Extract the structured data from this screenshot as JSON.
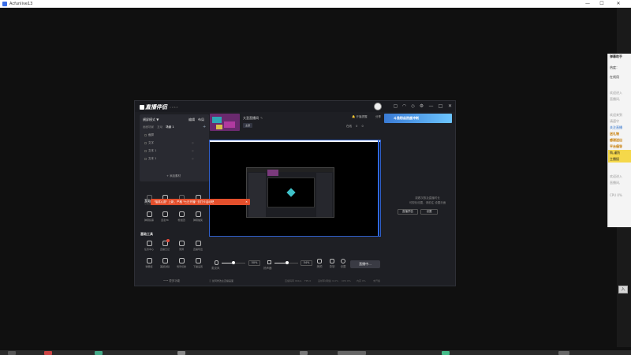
{
  "outer": {
    "title": "Acfunlive13",
    "minimize": "—",
    "maximize": "☐",
    "close": "✕"
  },
  "side_panel": {
    "lines": [
      "弹幕助手",
      "热度：",
      "在线用",
      "欢迎进入",
      "直播间,",
      "欢迎来到",
      "请遵守",
      "关注直播",
      "送礼物",
      "感谢送出",
      "平台倡导",
      "购,谨防",
      "主播接",
      "欢迎进入",
      "直播间,",
      "CPU 0%"
    ]
  },
  "right_tab": "入",
  "app": {
    "logo": "直播伴侣",
    "version": "v 2.4.4",
    "header_icons": [
      "message-icon",
      "headset-icon",
      "skin-icon",
      "settings-icon",
      "minimize-icon",
      "close-icon"
    ],
    "scene": {
      "mode": "横屏模式 ▼",
      "edit": "编辑",
      "layout": "布局",
      "tabs": [
        "画面场景",
        "互动",
        "场景 1"
      ],
      "active_tab": "场景 1",
      "plus": "+",
      "rows": [
        {
          "label": "截屏",
          "right": ""
        },
        {
          "label": "文字",
          "right": "◎"
        },
        {
          "label": "文本 1",
          "right": "◎"
        },
        {
          "label": "文本 1",
          "right": "◎"
        }
      ],
      "add_source": "+ 添加素材"
    },
    "alert": {
      "text": "\"抽奖心愿\" 上新，严格 \"七日开播\" 去打卡活动吧",
      "close": "✕",
      "under": "互动"
    },
    "tools_top": [
      {
        "label": "心愿目标",
        "name": "wish-icon",
        "dim": true
      },
      {
        "label": "观看送奖",
        "name": "gift-icon",
        "dim": false
      },
      {
        "label": "PK 赛事",
        "name": "pk-icon",
        "dim": true
      },
      {
        "label": "礼物红包",
        "name": "redpack-icon",
        "dim": false
      },
      {
        "label": "弹幕投票",
        "name": "vote-icon",
        "dim": false
      },
      {
        "label": "连麦PK",
        "name": "link-icon",
        "dim": false
      },
      {
        "label": "粉丝团",
        "name": "fans-icon",
        "dim": false
      },
      {
        "label": "弹幕抽奖",
        "name": "lottery-icon",
        "dim": false
      }
    ],
    "tools_title": "基础工具",
    "tools_bottom": [
      {
        "label": "任务中心",
        "name": "task-icon",
        "badge": false
      },
      {
        "label": "直播日记",
        "name": "diary-icon",
        "badge": true
      },
      {
        "label": "录屏",
        "name": "record-icon",
        "badge": false
      },
      {
        "label": "直播导出",
        "name": "export-icon",
        "badge": false
      },
      {
        "label": "弹幕姬",
        "name": "danmaku-icon",
        "badge": false
      },
      {
        "label": "美颜滤镜",
        "name": "beauty-icon",
        "badge": false
      },
      {
        "label": "场景切换",
        "name": "switch-icon",
        "badge": false
      },
      {
        "label": "下播设置",
        "name": "end-icon",
        "badge": false
      }
    ],
    "more": "••• 更多功能",
    "room": {
      "title": "大圣直播间",
      "edit": "✎",
      "tag": "主题",
      "notice": "开播提醒",
      "share": "分享",
      "banner": "斗鱼粉丝热度冲刺",
      "stats": [
        "在线",
        "0",
        "0"
      ]
    },
    "live_msg": {
      "line1": "观看次数及直播时长",
      "line2": "可视化设置，请前往 设置页面",
      "link": "设置页面",
      "btn_left": "直播预告",
      "btn_right": "设置"
    },
    "controls": {
      "mic_label": "麦克风",
      "mic_pct": "50%",
      "spk_label": "扬声器",
      "spk_pct": "54%",
      "beauty": "美颜",
      "record": "录制",
      "settings": "设置",
      "start": "直播中..."
    },
    "status": {
      "tip": "ⓘ 如何修改主直播画面",
      "fps": "直播码率 0Kb/s",
      "frames": "FPS 0",
      "drop": "丢帧率(网络) 0.0%",
      "cpu": "CPU 0%",
      "mem": "内存 0%",
      "net": "未开播"
    }
  }
}
